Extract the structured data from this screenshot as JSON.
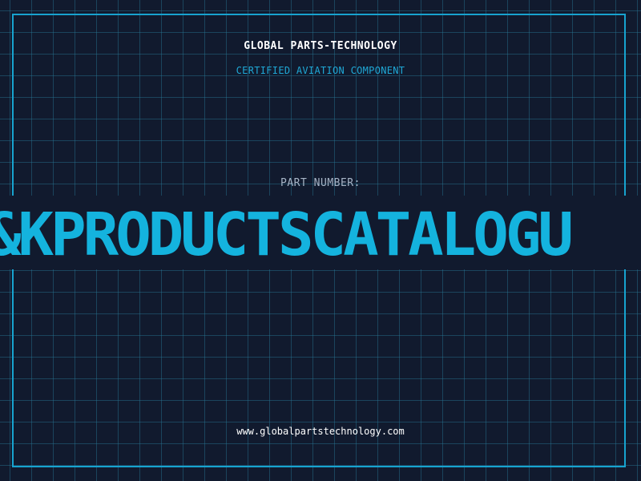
{
  "header": {
    "company": "GLOBAL PARTS-TECHNOLOGY",
    "subtitle": "CERTIFIED AVIATION COMPONENT"
  },
  "part": {
    "label": "PART NUMBER:",
    "number": "&KPRODUCTSCATALOGU"
  },
  "footer": {
    "url": "www.globalpartstechnology.com"
  },
  "colors": {
    "background": "#111a2e",
    "grid": "#287896",
    "frame": "#17a3cf",
    "accent": "#14b3de",
    "label": "#a6b4c6",
    "text": "#ffffff"
  }
}
